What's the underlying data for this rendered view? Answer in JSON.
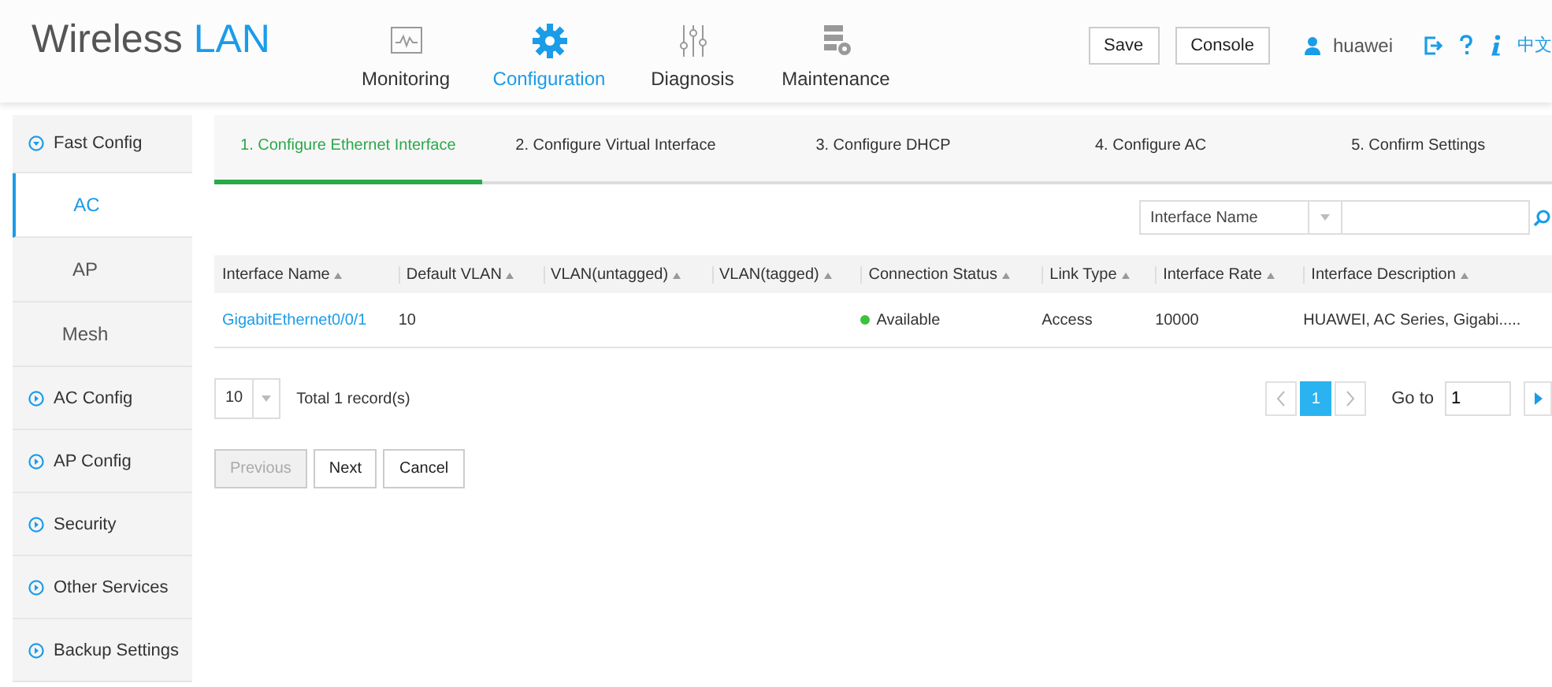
{
  "header": {
    "logo_primary": "Wireless",
    "logo_accent": "LAN",
    "nav": [
      {
        "label": "Monitoring",
        "selected": false
      },
      {
        "label": "Configuration",
        "selected": true
      },
      {
        "label": "Diagnosis",
        "selected": false
      },
      {
        "label": "Maintenance",
        "selected": false
      }
    ],
    "buttons": [
      "Save",
      "Console"
    ],
    "user": "huawei",
    "language": "中文"
  },
  "sidebar": {
    "items": [
      {
        "label": "Fast Config",
        "kind": "group",
        "expanded": true,
        "children": [
          {
            "label": "AC",
            "kind": "sub",
            "selected": true
          },
          {
            "label": "AP",
            "kind": "sub",
            "selected": false
          },
          {
            "label": "Mesh",
            "kind": "sub",
            "selected": false
          }
        ]
      },
      {
        "label": "AC Config",
        "kind": "group",
        "expanded": false
      },
      {
        "label": "AP Config",
        "kind": "group",
        "expanded": false
      },
      {
        "label": "Security",
        "kind": "group",
        "expanded": false
      },
      {
        "label": "Other Services",
        "kind": "group",
        "expanded": false
      },
      {
        "label": "Backup Settings",
        "kind": "group",
        "expanded": false
      }
    ]
  },
  "steps": [
    {
      "label": "1. Configure Ethernet Interface",
      "selected": true
    },
    {
      "label": "2. Configure Virtual Interface",
      "selected": false
    },
    {
      "label": "3. Configure DHCP",
      "selected": false
    },
    {
      "label": "4. Configure AC",
      "selected": false
    },
    {
      "label": "5. Confirm Settings",
      "selected": false
    }
  ],
  "search": {
    "field": "Interface Name"
  },
  "table": {
    "columns": [
      "Interface Name",
      "Default VLAN",
      "VLAN(untagged)",
      "VLAN(tagged)",
      "Connection Status",
      "Link Type",
      "Interface Rate",
      "Interface Description"
    ],
    "rows": [
      {
        "cells": [
          "GigabitEthernet0/0/1",
          "10",
          "",
          "",
          "Available",
          "Access",
          "10000",
          "HUAWEI, AC Series, Gigabi....."
        ],
        "color": "#3cc23c"
      }
    ]
  },
  "pagination": {
    "page_size": "10",
    "total": "Total 1 record(s)",
    "pages": [
      {
        "label": "1",
        "selected": true
      }
    ],
    "goto_label": "Go to",
    "goto_value": "1"
  },
  "actions": [
    {
      "label": "Previous",
      "disabled": true
    },
    {
      "label": "Next",
      "disabled": false
    },
    {
      "label": "Cancel",
      "disabled": false
    }
  ]
}
